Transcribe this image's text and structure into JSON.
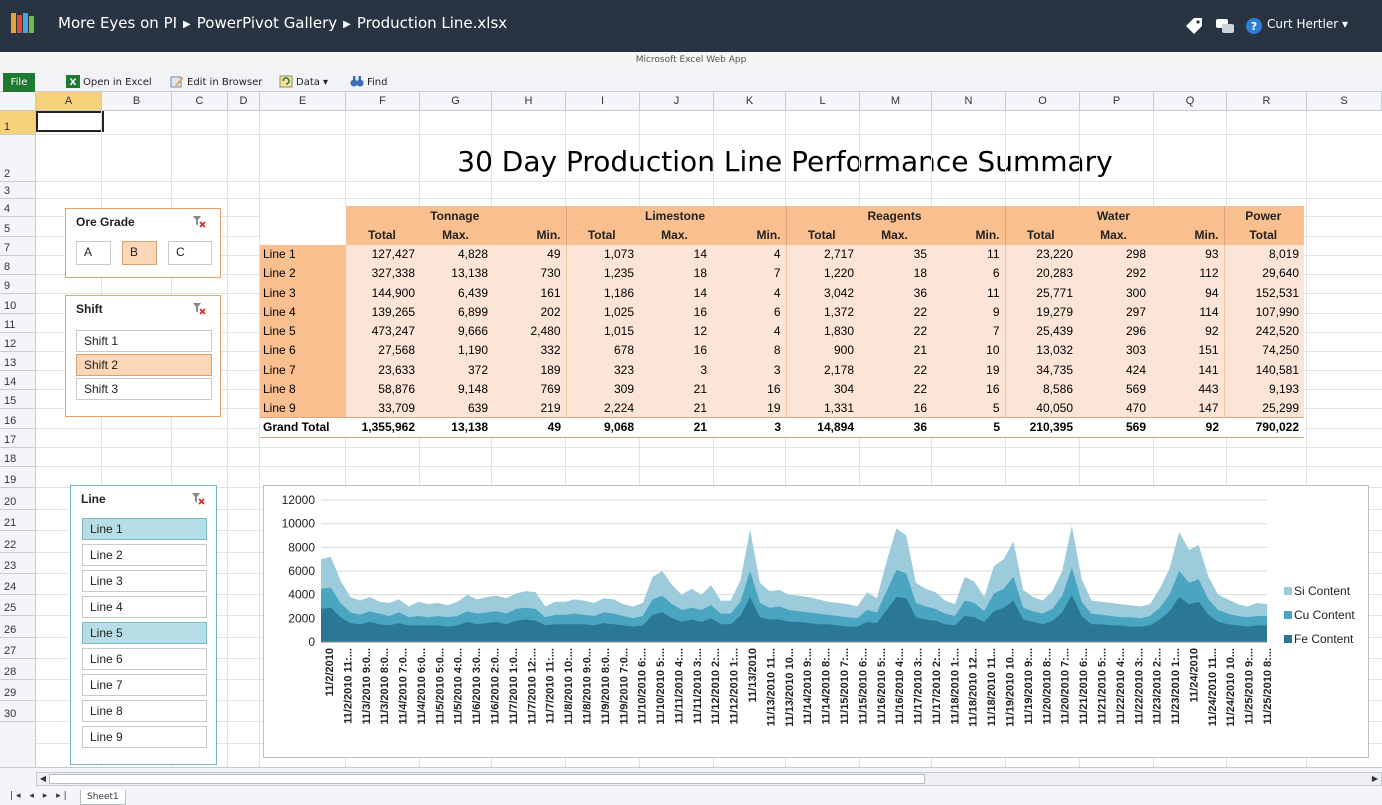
{
  "topbar": {
    "crumbs": [
      "More Eyes on PI",
      "PowerPivot Gallery",
      "Production Line.xlsx"
    ],
    "user": "Curt Hertler ▾",
    "icons": [
      "tag-icon",
      "social-icon",
      "help-icon"
    ]
  },
  "app_name": "Microsoft Excel Web App",
  "ribbon": {
    "file": "File",
    "open_in_excel": "Open in Excel",
    "edit_in_browser": "Edit in Browser",
    "data": "Data ▾",
    "find": "Find"
  },
  "columns": [
    "A",
    "B",
    "C",
    "D",
    "E",
    "F",
    "G",
    "H",
    "I",
    "J",
    "K",
    "L",
    "M",
    "N",
    "O",
    "P",
    "Q",
    "R",
    "S"
  ],
  "rows": [
    "1",
    "2",
    "3",
    "4",
    "5",
    "7",
    "8",
    "9",
    "10",
    "11",
    "12",
    "13",
    "14",
    "15",
    "16",
    "17",
    "18",
    "19",
    "20",
    "21",
    "22",
    "23",
    "24",
    "25",
    "26",
    "27",
    "28",
    "29",
    "30"
  ],
  "title": "30 Day Production Line Performance Summary",
  "slicers": {
    "ore_grade": {
      "header": "Ore Grade",
      "items": [
        "A",
        "B",
        "C"
      ],
      "selected": [
        "B"
      ]
    },
    "shift": {
      "header": "Shift",
      "items": [
        "Shift 1",
        "Shift 2",
        "Shift 3"
      ],
      "selected": [
        "Shift 2"
      ]
    },
    "line": {
      "header": "Line",
      "items": [
        "Line 1",
        "Line 2",
        "Line 3",
        "Line 4",
        "Line 5",
        "Line 6",
        "Line 7",
        "Line 8",
        "Line 9"
      ],
      "selected": [
        "Line 1",
        "Line 5"
      ]
    }
  },
  "pivot": {
    "groups": [
      "Tonnage",
      "Limestone",
      "Reagents",
      "Water",
      "Power"
    ],
    "subheaders": [
      "Total",
      "Max.",
      "Min.",
      "Total",
      "Max.",
      "Min.",
      "Total",
      "Max.",
      "Min.",
      "Total",
      "Max.",
      "Min.",
      "Total"
    ],
    "rows": [
      {
        "label": "Line 1",
        "values": [
          "127,427",
          "4,828",
          "49",
          "1,073",
          "14",
          "4",
          "2,717",
          "35",
          "11",
          "23,220",
          "298",
          "93",
          "8,019"
        ]
      },
      {
        "label": "Line 2",
        "values": [
          "327,338",
          "13,138",
          "730",
          "1,235",
          "18",
          "7",
          "1,220",
          "18",
          "6",
          "20,283",
          "292",
          "112",
          "29,640"
        ]
      },
      {
        "label": "Line 3",
        "values": [
          "144,900",
          "6,439",
          "161",
          "1,186",
          "14",
          "4",
          "3,042",
          "36",
          "11",
          "25,771",
          "300",
          "94",
          "152,531"
        ]
      },
      {
        "label": "Line 4",
        "values": [
          "139,265",
          "6,899",
          "202",
          "1,025",
          "16",
          "6",
          "1,372",
          "22",
          "9",
          "19,279",
          "297",
          "114",
          "107,990"
        ]
      },
      {
        "label": "Line 5",
        "values": [
          "473,247",
          "9,666",
          "2,480",
          "1,015",
          "12",
          "4",
          "1,830",
          "22",
          "7",
          "25,439",
          "296",
          "92",
          "242,520"
        ]
      },
      {
        "label": "Line 6",
        "values": [
          "27,568",
          "1,190",
          "332",
          "678",
          "16",
          "8",
          "900",
          "21",
          "10",
          "13,032",
          "303",
          "151",
          "74,250"
        ]
      },
      {
        "label": "Line 7",
        "values": [
          "23,633",
          "372",
          "189",
          "323",
          "3",
          "3",
          "2,178",
          "22",
          "19",
          "34,735",
          "424",
          "141",
          "140,581"
        ]
      },
      {
        "label": "Line 8",
        "values": [
          "58,876",
          "9,148",
          "769",
          "309",
          "21",
          "16",
          "304",
          "22",
          "16",
          "8,586",
          "569",
          "443",
          "9,193"
        ]
      },
      {
        "label": "Line 9",
        "values": [
          "33,709",
          "639",
          "219",
          "2,224",
          "21",
          "19",
          "1,331",
          "16",
          "5",
          "40,050",
          "470",
          "147",
          "25,299"
        ]
      }
    ],
    "grand_total": {
      "label": "Grand Total",
      "values": [
        "1,355,962",
        "13,138",
        "49",
        "9,068",
        "21",
        "3",
        "14,894",
        "36",
        "5",
        "210,395",
        "569",
        "92",
        "790,022"
      ]
    }
  },
  "chart_data": {
    "type": "area",
    "stacked": true,
    "ylim": [
      0,
      12000
    ],
    "yticks": [
      "0",
      "2000",
      "4000",
      "6000",
      "8000",
      "10000",
      "12000"
    ],
    "x_tick_labels": [
      "11/2/2010",
      "11/2/2010 11:...",
      "11/3/2010 9:0...",
      "11/3/2010 8:0...",
      "11/4/2010 7:0...",
      "11/4/2010 6:0...",
      "11/5/2010 5:0...",
      "11/5/2010 4:0...",
      "11/6/2010 3:0...",
      "11/6/2010 2:0...",
      "11/7/2010 1:0...",
      "11/7/2010 12:...",
      "11/7/2010 11:...",
      "11/8/2010 10:...",
      "11/8/2010 9:0...",
      "11/9/2010 8:0...",
      "11/9/2010 7:0...",
      "11/10/2010 6:...",
      "11/10/2010 5:...",
      "11/11/2010 4:...",
      "11/11/2010 3:...",
      "11/12/2010 2:...",
      "11/12/2010 1:...",
      "11/13/2010",
      "11/13/2010 11...",
      "11/13/2010 10...",
      "11/14/2010 9:...",
      "11/14/2010 8:...",
      "11/15/2010 7:...",
      "11/15/2010 6:...",
      "11/16/2010 5:...",
      "11/16/2010 4:...",
      "11/17/2010 3:...",
      "11/17/2010 2:...",
      "11/18/2010 1:...",
      "11/18/2010 12...",
      "11/18/2010 11...",
      "11/19/2010 10...",
      "11/19/2010 9:...",
      "11/20/2010 8:...",
      "11/20/2010 7:...",
      "11/21/2010 6:...",
      "11/21/2010 5:...",
      "11/22/2010 4:...",
      "11/22/2010 3:...",
      "11/23/2010 2:...",
      "11/23/2010 1:...",
      "11/24/2010",
      "11/24/2010 11...",
      "11/24/2010 10...",
      "11/25/2010 9:...",
      "11/25/2010 8:..."
    ],
    "series": [
      {
        "name": "Si Content",
        "color": "#9ccbdb",
        "values": [
          7000,
          7200,
          5200,
          3800,
          3500,
          3800,
          3400,
          3300,
          3600,
          3000,
          3400,
          3200,
          3300,
          3100,
          3400,
          4000,
          3600,
          3800,
          3900,
          3700,
          4100,
          4300,
          4200,
          3000,
          3400,
          3400,
          3600,
          3500,
          3300,
          3700,
          3600,
          3200,
          3000,
          3300,
          5500,
          6000,
          4800,
          4000,
          4500,
          4000,
          4800,
          3500,
          3500,
          5200,
          9500,
          5000,
          4300,
          4400,
          4000,
          3900,
          3800,
          3600,
          3400,
          3300,
          3200,
          3000,
          4200,
          3700,
          6800,
          9600,
          9000,
          5000,
          4500,
          4200,
          3500,
          3200,
          5500,
          5100,
          3800,
          6400,
          7000,
          8500,
          4400,
          3800,
          3500,
          4300,
          6000,
          9800,
          5300,
          3500,
          3400,
          3300,
          3200,
          3100,
          3000,
          3200,
          4500,
          6200,
          9300,
          7800,
          8200,
          5500,
          4000,
          3600,
          3200,
          3000,
          3300,
          3200
        ]
      },
      {
        "name": "Cu Content",
        "color": "#4aa5c1",
        "values": [
          4500,
          4600,
          3300,
          2500,
          2300,
          2600,
          2400,
          2200,
          2500,
          2100,
          2200,
          2100,
          2200,
          2100,
          2200,
          2600,
          2400,
          2500,
          2600,
          2400,
          2800,
          2900,
          2800,
          2100,
          2300,
          2300,
          2400,
          2300,
          2200,
          2500,
          2400,
          2200,
          2000,
          2200,
          3600,
          3900,
          3200,
          2700,
          2900,
          2700,
          3100,
          2400,
          2400,
          3400,
          6000,
          3300,
          2900,
          3000,
          2700,
          2600,
          2500,
          2400,
          2300,
          2200,
          2100,
          2000,
          2700,
          2500,
          4300,
          6100,
          5800,
          3300,
          3000,
          2800,
          2400,
          2200,
          3500,
          3300,
          2600,
          4100,
          4500,
          5500,
          2900,
          2600,
          2400,
          2800,
          3900,
          6300,
          3400,
          2400,
          2300,
          2200,
          2100,
          2100,
          2000,
          2200,
          2900,
          4000,
          6000,
          5000,
          5300,
          3600,
          2700,
          2400,
          2200,
          2100,
          2200,
          2200
        ]
      },
      {
        "name": "Fe Content",
        "color": "#2a7895",
        "values": [
          2800,
          2900,
          2100,
          1600,
          1500,
          1700,
          1500,
          1400,
          1600,
          1400,
          1400,
          1400,
          1400,
          1300,
          1400,
          1700,
          1500,
          1600,
          1700,
          1500,
          1800,
          1900,
          1800,
          1400,
          1500,
          1500,
          1500,
          1500,
          1400,
          1600,
          1500,
          1400,
          1300,
          1400,
          2300,
          2500,
          2000,
          1700,
          1900,
          1700,
          2000,
          1500,
          1500,
          2200,
          3800,
          2100,
          1900,
          1900,
          1700,
          1700,
          1600,
          1500,
          1500,
          1400,
          1300,
          1300,
          1700,
          1600,
          2700,
          3800,
          3700,
          2100,
          1900,
          1800,
          1500,
          1400,
          2200,
          2100,
          1700,
          2600,
          2900,
          3500,
          1900,
          1700,
          1500,
          1800,
          2500,
          4000,
          2200,
          1500,
          1500,
          1400,
          1400,
          1300,
          1300,
          1400,
          1900,
          2600,
          3800,
          3200,
          3400,
          2300,
          1700,
          1500,
          1400,
          1300,
          1400,
          1400
        ]
      }
    ]
  },
  "sheet": {
    "tab": "Sheet1",
    "nav": "|◂ ◂ ▸ ▸|"
  }
}
